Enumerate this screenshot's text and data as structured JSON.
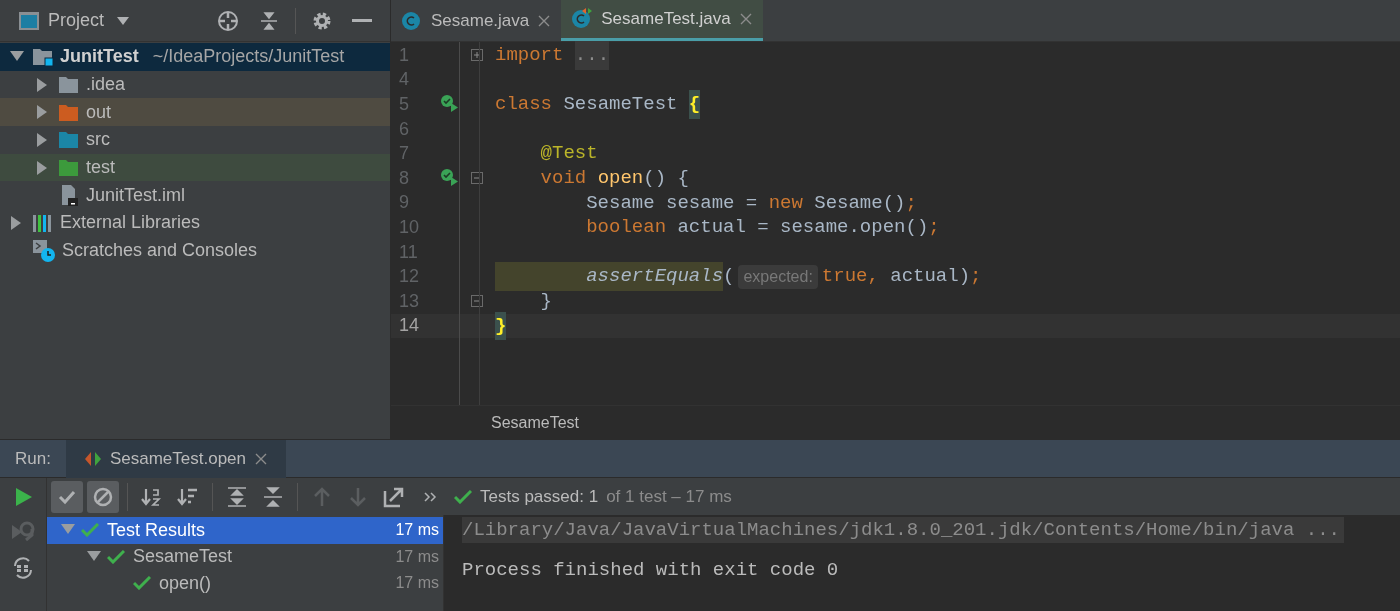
{
  "project_panel": {
    "title": "Project",
    "tree": [
      {
        "name": "JunitTest",
        "path": "~/IdeaProjects/JunitTest",
        "kind": "module",
        "expanded": true,
        "selected": true,
        "children": [
          {
            "name": ".idea",
            "kind": "folder",
            "expanded": false,
            "selected": false
          },
          {
            "name": "out",
            "kind": "excluded_folder",
            "expanded": false,
            "selected": false
          },
          {
            "name": "src",
            "kind": "source_folder",
            "expanded": false,
            "selected": false
          },
          {
            "name": "test",
            "kind": "test_folder",
            "expanded": false,
            "selected": false
          },
          {
            "name": "JunitTest.iml",
            "kind": "iml_file",
            "selected": false
          }
        ]
      },
      {
        "name": "External Libraries",
        "kind": "libraries",
        "expanded": false,
        "selected": false
      },
      {
        "name": "Scratches and Consoles",
        "kind": "scratches",
        "selected": false
      }
    ]
  },
  "editor": {
    "tabs": [
      {
        "label": "Sesame.java",
        "kind": "class",
        "selected": false
      },
      {
        "label": "SesameTest.java",
        "kind": "test_class",
        "selected": true
      }
    ],
    "lines": [
      {
        "number": "1",
        "folded": true,
        "run_marker": false,
        "current": false,
        "tokens": [
          {
            "kind": "keyword",
            "text": "import "
          },
          {
            "kind": "folded",
            "text": "..."
          }
        ]
      },
      {
        "number": "4",
        "run_marker": false,
        "current": false
      },
      {
        "number": "5",
        "run_marker": true,
        "current": false,
        "tokens": [
          {
            "kind": "keyword",
            "text": "class "
          },
          {
            "kind": "plain",
            "text": "SesameTest "
          },
          {
            "kind": "brace",
            "text": "{"
          }
        ]
      },
      {
        "number": "6",
        "run_marker": false,
        "current": false
      },
      {
        "number": "7",
        "run_marker": false,
        "current": false,
        "tokens": [
          {
            "kind": "annotation",
            "text": "    @Test"
          }
        ]
      },
      {
        "number": "8",
        "folded": false,
        "run_marker": true,
        "current": false,
        "tokens": [
          {
            "kind": "keyword",
            "text": "    void "
          },
          {
            "kind": "method",
            "text": "open"
          },
          {
            "kind": "plain",
            "text": "() {"
          }
        ]
      },
      {
        "number": "9",
        "run_marker": false,
        "current": false,
        "tokens": [
          {
            "kind": "plain",
            "text": "        Sesame sesame = "
          },
          {
            "kind": "keyword",
            "text": "new "
          },
          {
            "kind": "plain",
            "text": "Sesame()"
          },
          {
            "kind": "keyword",
            "text": ";"
          }
        ]
      },
      {
        "number": "10",
        "run_marker": false,
        "current": false,
        "tokens": [
          {
            "kind": "keyword",
            "text": "        boolean "
          },
          {
            "kind": "plain",
            "text": "actual = sesame.open()"
          },
          {
            "kind": "keyword",
            "text": ";"
          }
        ]
      },
      {
        "number": "11",
        "run_marker": false,
        "current": false
      },
      {
        "number": "12",
        "run_marker": false,
        "current": false,
        "tokens": [
          {
            "kind": "static_call",
            "text": "        assertEquals"
          },
          {
            "kind": "plain",
            "text": "("
          },
          {
            "kind": "hint",
            "text": "expected:"
          },
          {
            "kind": "keyword",
            "text": "true, "
          },
          {
            "kind": "plain",
            "text": "actual)"
          },
          {
            "kind": "keyword",
            "text": ";"
          }
        ]
      },
      {
        "number": "13",
        "folded": false,
        "run_marker": false,
        "current": false,
        "tokens": [
          {
            "kind": "plain",
            "text": "    }"
          }
        ]
      },
      {
        "number": "14",
        "run_marker": false,
        "current": true,
        "tokens": [
          {
            "kind": "brace",
            "text": "}"
          }
        ]
      }
    ],
    "breadcrumb": "SesameTest"
  },
  "run_panel": {
    "label": "Run:",
    "tab": {
      "label": "SesameTest.open",
      "selected": true
    },
    "side_tools": [
      {
        "kind": "run",
        "disabled": false
      },
      {
        "kind": "rerun_failed",
        "disabled": true
      },
      {
        "kind": "toggle_auto",
        "disabled": false
      }
    ],
    "toolbar": [
      {
        "kind": "show_passed",
        "pressed": true,
        "disabled": false
      },
      {
        "kind": "show_ignored",
        "pressed": true,
        "disabled": false
      },
      {
        "kind": "sort_alpha",
        "pressed": false,
        "disabled": false
      },
      {
        "kind": "sort_duration",
        "pressed": false,
        "disabled": false
      },
      {
        "kind": "expand_all",
        "pressed": false,
        "disabled": false
      },
      {
        "kind": "collapse_all",
        "pressed": false,
        "disabled": false
      },
      {
        "kind": "prev",
        "pressed": false,
        "disabled": true
      },
      {
        "kind": "next",
        "pressed": false,
        "disabled": true
      },
      {
        "kind": "export",
        "pressed": false,
        "disabled": false
      },
      {
        "kind": "more",
        "pressed": false,
        "disabled": false
      }
    ],
    "summary": {
      "passed": true,
      "label": "Tests passed: 1",
      "detail": "of 1 test – 17 ms"
    },
    "results": [
      {
        "name": "Test Results",
        "time": "17 ms",
        "passed": true,
        "expanded": true,
        "selected": true,
        "children": [
          {
            "name": "SesameTest",
            "time": "17 ms",
            "passed": true,
            "expanded": true,
            "selected": false,
            "children": [
              {
                "name": "open()",
                "time": "17 ms",
                "passed": true,
                "selected": false
              }
            ]
          }
        ]
      }
    ],
    "console": [
      {
        "kind": "command",
        "text": "/Library/Java/JavaVirtualMachines/jdk1.8.0_201.jdk/Contents/Home/bin/java ..."
      },
      {
        "kind": "output",
        "text": "Process finished with exit code 0"
      }
    ]
  }
}
